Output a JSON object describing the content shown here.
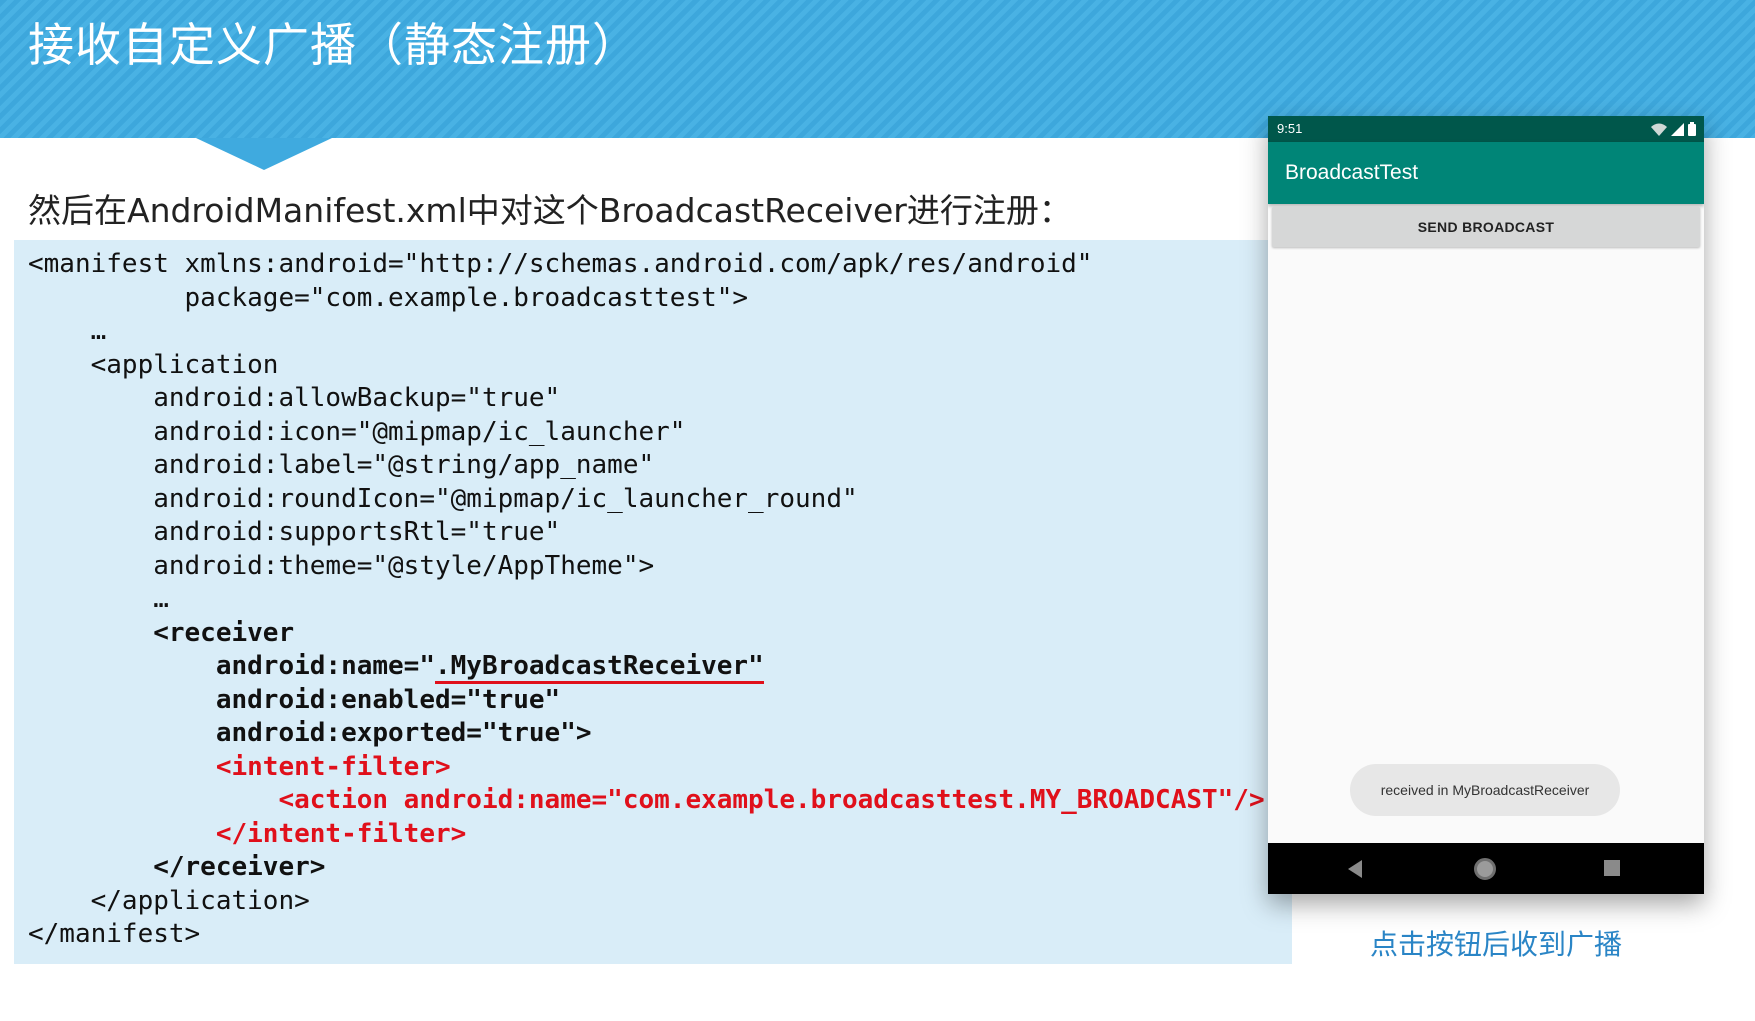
{
  "slide": {
    "title": "接收自定义广播（静态注册）",
    "intro": "然后在AndroidManifest.xml中对这个BroadcastReceiver进行注册：",
    "caption": "点击按钮后收到广播"
  },
  "code": {
    "l1": "<manifest xmlns:android=\"http://schemas.android.com/apk/res/android\"",
    "l2": "          package=\"com.example.broadcasttest\">",
    "l3": "    …",
    "l4": "    <application",
    "l5": "        android:allowBackup=\"true\"",
    "l6": "        android:icon=\"@mipmap/ic_launcher\"",
    "l7": "        android:label=\"@string/app_name\"",
    "l8": "        android:roundIcon=\"@mipmap/ic_launcher_round\"",
    "l9": "        android:supportsRtl=\"true\"",
    "l10": "        android:theme=\"@style/AppTheme\">",
    "l11": "        …",
    "l12": "        <receiver",
    "l13a": "            android:name=\"",
    "l13b": ".MyBroadcastReceiver\"",
    "l14": "            android:enabled=\"true\"",
    "l15": "            android:exported=\"true\">",
    "l16": "            <intent-filter>",
    "l17": "                <action android:name=\"com.example.broadcasttest.MY_BROADCAST\"/>",
    "l18": "            </intent-filter>",
    "l19": "        </receiver>",
    "l20": "    </application>",
    "l21": "</manifest>"
  },
  "phone": {
    "time": "9:51",
    "app_title": "BroadcastTest",
    "button_label": "SEND BROADCAST",
    "toast": "received in MyBroadcastReceiver",
    "status_icons": [
      "wifi-icon",
      "signal-icon",
      "battery-icon"
    ],
    "nav_icons": [
      "back-icon",
      "home-icon",
      "recents-icon"
    ]
  },
  "colors": {
    "banner": "#3da7dc",
    "code_bg": "#d9edf8",
    "highlight": "#e0101b",
    "status_bar": "#00574b",
    "app_bar": "#008577",
    "caption": "#2a85c6"
  }
}
